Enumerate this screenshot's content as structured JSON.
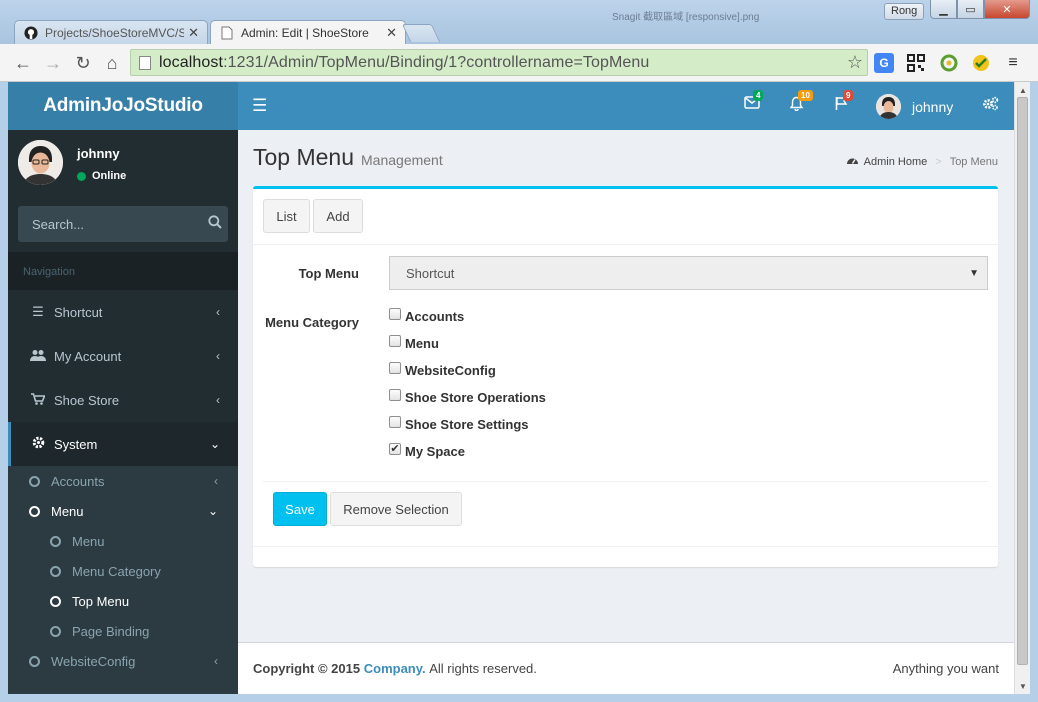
{
  "browser": {
    "tabs": [
      {
        "title": "Projects/ShoeStoreMVC/S",
        "favicon": "github-icon",
        "active": false
      },
      {
        "title": "Admin: Edit | ShoeStore",
        "favicon": "page-icon",
        "active": true
      }
    ],
    "blurred_title": "Snagit 截取區域 [responsive].png",
    "user_label": "Rong",
    "url_host": "localhost",
    "url_rest": ":1231/Admin/TopMenu/Binding/1?controllername=TopMenu"
  },
  "app": {
    "logo_bold": "Admin",
    "logo_rest": "JoJoStudio",
    "notifications": {
      "messages": "4",
      "alerts": "10",
      "flags": "9"
    },
    "user_name": "johnny",
    "status": "Online",
    "search_placeholder": "Search...",
    "nav_header": "Navigation"
  },
  "sidebar": {
    "items": [
      {
        "label": "Shortcut",
        "icon": "list-icon"
      },
      {
        "label": "My Account",
        "icon": "users-icon"
      },
      {
        "label": "Shoe Store",
        "icon": "cart-icon"
      },
      {
        "label": "System",
        "icon": "gear-icon"
      }
    ],
    "subitems": [
      {
        "label": "Accounts"
      },
      {
        "label": "Menu"
      },
      {
        "label": "Menu"
      },
      {
        "label": "Menu Category"
      },
      {
        "label": "Top Menu"
      },
      {
        "label": "Page Binding"
      },
      {
        "label": "WebsiteConfig"
      }
    ]
  },
  "content": {
    "title": "Top Menu",
    "subtitle": "Management",
    "breadcrumb": [
      "Admin Home",
      "Top Menu"
    ],
    "buttons": {
      "list": "List",
      "add": "Add",
      "save": "Save",
      "remove": "Remove Selection"
    },
    "form": {
      "top_menu_label": "Top Menu",
      "top_menu_value": "Shortcut",
      "category_label": "Menu Category",
      "categories": [
        {
          "label": "Accounts",
          "checked": false
        },
        {
          "label": "Menu",
          "checked": false
        },
        {
          "label": "WebsiteConfig",
          "checked": false
        },
        {
          "label": "Shoe Store Operations",
          "checked": false
        },
        {
          "label": "Shoe Store Settings",
          "checked": false
        },
        {
          "label": "My Space",
          "checked": true
        }
      ]
    }
  },
  "footer": {
    "copyright": "Copyright © 2015",
    "company": "Company.",
    "rights": "All rights reserved.",
    "right_text": "Anything you want"
  },
  "colors": {
    "header": "#3c8dbc",
    "logo": "#367fa9",
    "sidebar": "#222d32",
    "accent": "#00c0ef"
  }
}
